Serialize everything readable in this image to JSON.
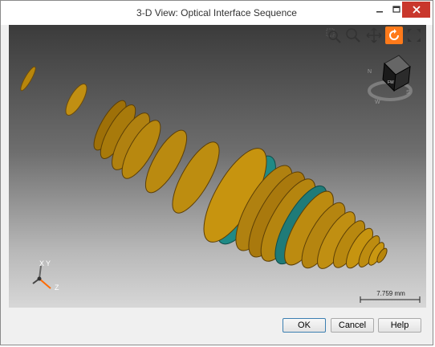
{
  "window": {
    "title": "3-D View: Optical Interface Sequence"
  },
  "toolbar": {
    "icons": [
      "zoom-region-icon",
      "zoom-icon",
      "pan-icon",
      "rotate-icon",
      "fit-view-icon"
    ]
  },
  "viewcube": {
    "face_label": "FW"
  },
  "axes": {
    "x": "X",
    "y": "Y",
    "z": "Z"
  },
  "scale": {
    "label": "7.759 mm"
  },
  "buttons": {
    "ok": "OK",
    "cancel": "Cancel",
    "help": "Help"
  },
  "colors": {
    "lens_fill": "#b8860b",
    "lens_dark": "#6b4b0a",
    "lens_teal": "#1f8a86",
    "rotate_active": "#ff7a1a",
    "close_button": "#c9372c"
  }
}
